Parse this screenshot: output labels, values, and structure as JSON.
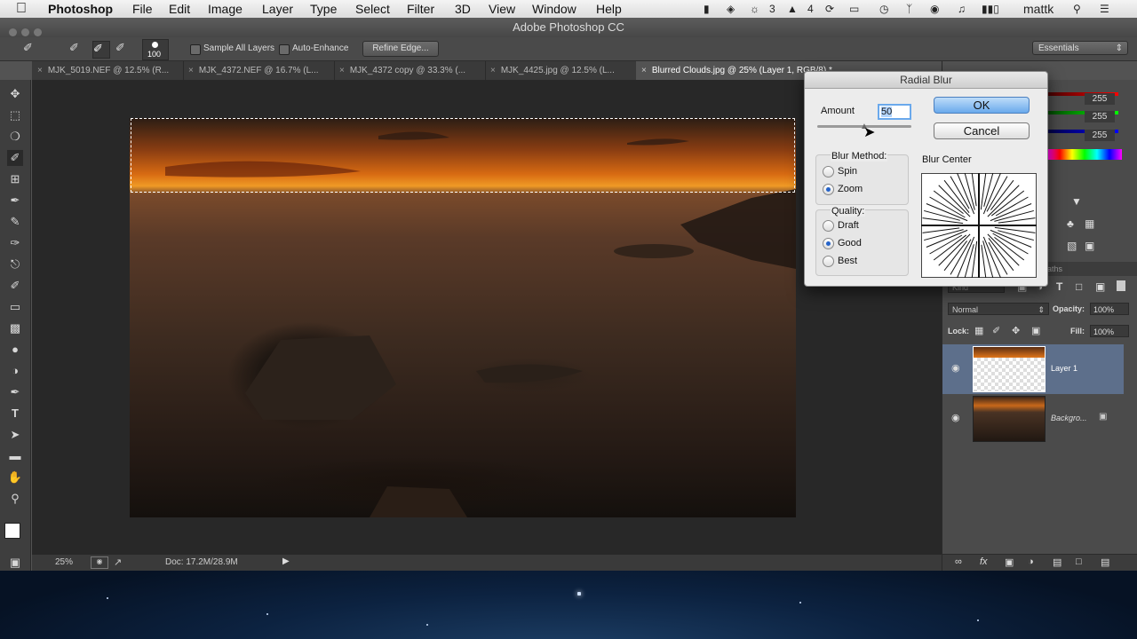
{
  "menubar": {
    "app": "Photoshop",
    "items": [
      "File",
      "Edit",
      "Image",
      "Layer",
      "Type",
      "Select",
      "Filter",
      "3D",
      "View",
      "Window",
      "Help"
    ],
    "tray": {
      "badge1": "3",
      "badge2": "4",
      "user": "mattk"
    }
  },
  "titlebar": {
    "title": "Adobe Photoshop CC"
  },
  "options": {
    "brush_size": "100",
    "sample_all_layers": "Sample All Layers",
    "auto_enhance": "Auto-Enhance",
    "refine_edge": "Refine Edge...",
    "workspace": "Essentials"
  },
  "tabs": [
    {
      "label": "MJK_5019.NEF @ 12.5% (R..."
    },
    {
      "label": "MJK_4372.NEF @ 16.7% (L..."
    },
    {
      "label": "MJK_4372 copy @ 33.3% (..."
    },
    {
      "label": "MJK_4425.jpg @ 12.5% (L..."
    },
    {
      "label": "Blurred Clouds.jpg @ 25% (Layer 1, RGB/8) *"
    }
  ],
  "status": {
    "zoom": "25%",
    "doc": "Doc: 17.2M/28.9M"
  },
  "dialog": {
    "title": "Radial Blur",
    "amount_label": "Amount",
    "amount_value": "50",
    "amount_max": 100,
    "ok": "OK",
    "cancel": "Cancel",
    "blur_method_label": "Blur Method:",
    "spin": "Spin",
    "zoom": "Zoom",
    "blur_method_selected": "Zoom",
    "quality_label": "Quality:",
    "draft": "Draft",
    "good": "Good",
    "best": "Best",
    "quality_selected": "Good",
    "blur_center_label": "Blur Center"
  },
  "color_panel": {
    "r": "255",
    "g": "255",
    "b": "255"
  },
  "layers": {
    "kind_label": "Kind",
    "blend_mode": "Normal",
    "opacity_label": "Opacity:",
    "opacity": "100%",
    "lock_label": "Lock:",
    "fill_label": "Fill:",
    "fill": "100%",
    "panel_tab": "aths",
    "items": [
      {
        "name": "Layer 1"
      },
      {
        "name": "Backgro..."
      }
    ]
  }
}
